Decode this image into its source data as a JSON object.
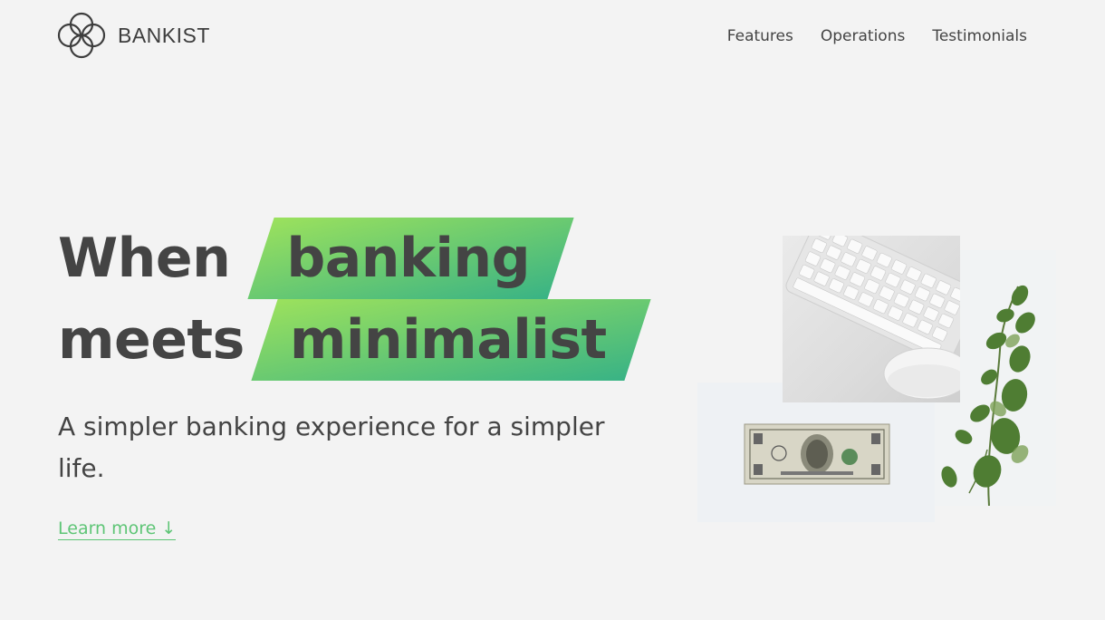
{
  "brand": {
    "name": "BANKIST",
    "logo_icon": "bankist-logo-icon"
  },
  "nav": {
    "links": [
      {
        "label": "Features"
      },
      {
        "label": "Operations"
      },
      {
        "label": "Testimonials"
      }
    ]
  },
  "hero": {
    "title_line1_plain": "When",
    "title_line1_highlight": "banking",
    "title_line2_plain": "meets",
    "title_line2_highlight": "minimalist",
    "subtitle": "A simpler banking experience for a simpler life.",
    "cta_label": "Learn more ↓",
    "highlight_gradient": [
      "#9be15d",
      "#39b385"
    ],
    "accent_color": "#5ec576"
  }
}
